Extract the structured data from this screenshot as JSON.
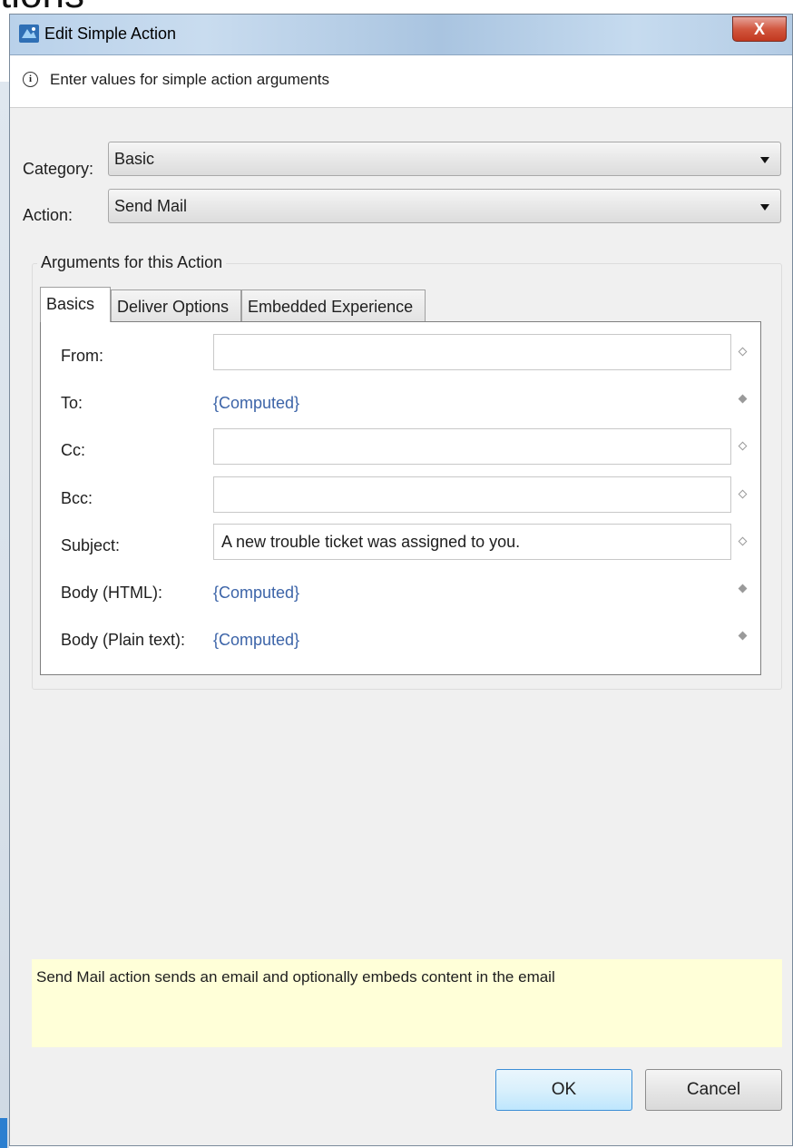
{
  "background_text": "tions",
  "dialog": {
    "title": "Edit Simple Action",
    "close_label": "X",
    "info_text": "Enter values for simple action arguments",
    "category": {
      "label": "Category:",
      "value": "Basic"
    },
    "action": {
      "label": "Action:",
      "value": "Send Mail"
    },
    "group_title": "Arguments for this Action",
    "tabs": [
      {
        "label": "Basics",
        "active": true
      },
      {
        "label": "Deliver Options",
        "active": false
      },
      {
        "label": "Embedded Experience",
        "active": false
      }
    ],
    "arguments": {
      "from": {
        "label": "From:",
        "value": ""
      },
      "to": {
        "label": "To:",
        "value": "{Computed}"
      },
      "cc": {
        "label": "Cc:",
        "value": ""
      },
      "bcc": {
        "label": "Bcc:",
        "value": ""
      },
      "subject": {
        "label": "Subject:",
        "value": "A new trouble ticket was assigned to you."
      },
      "body_html": {
        "label": "Body (HTML):",
        "value": "{Computed}"
      },
      "body_plain": {
        "label": "Body (Plain text):",
        "value": "{Computed}"
      }
    },
    "description": "Send Mail action sends an email and optionally embeds content in the email",
    "buttons": {
      "ok": "OK",
      "cancel": "Cancel"
    }
  },
  "colors": {
    "accent": "#3c8ed6",
    "computed_link": "#3c64a8",
    "description_bg": "#ffffd8",
    "close_button": "#c2381f"
  },
  "icons": {
    "app": "app-icon",
    "info": "info-icon",
    "dropdown": "chevron-down-icon",
    "static_value": "hollow-diamond-icon",
    "computed_value": "filled-diamond-icon"
  }
}
